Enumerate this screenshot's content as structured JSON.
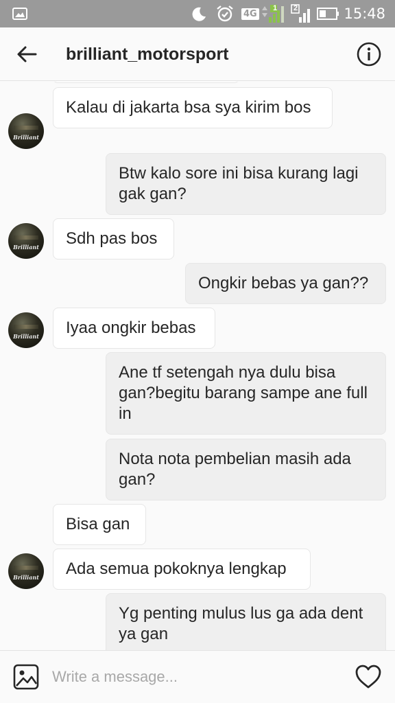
{
  "status_bar": {
    "time": "15:48",
    "network": "4G",
    "sim1": "1",
    "sim2": "2"
  },
  "header": {
    "title": "brilliant_motorsport"
  },
  "avatar": {
    "label": "Brilliant"
  },
  "messages": [
    {
      "from": "them",
      "text": "Kalau di jakarta bsa sya kirim bos",
      "avatar": true
    },
    {
      "from": "me",
      "text": "Btw kalo sore ini bisa kurang lagi gak gan?"
    },
    {
      "from": "them",
      "text": "Sdh pas bos",
      "avatar": true
    },
    {
      "from": "me",
      "text": "Ongkir bebas ya gan??"
    },
    {
      "from": "them",
      "text": "Iyaa ongkir bebas",
      "avatar": true
    },
    {
      "from": "me",
      "text": "Ane tf setengah nya dulu bisa gan?begitu barang sampe ane full in"
    },
    {
      "from": "me",
      "text": "Nota nota pembelian masih ada gan?"
    },
    {
      "from": "them",
      "text": "Bisa gan",
      "avatar": false
    },
    {
      "from": "them",
      "text": "Ada semua pokoknya lengkap",
      "avatar": true
    },
    {
      "from": "me",
      "text": "Yg penting mulus lus ga ada dent ya gan"
    }
  ],
  "composer": {
    "placeholder": "Write a message..."
  },
  "colors": {
    "status_bar": "#9a9a9a",
    "incoming_bubble": "#ffffff",
    "outgoing_bubble": "#efefef",
    "text": "#262626"
  }
}
